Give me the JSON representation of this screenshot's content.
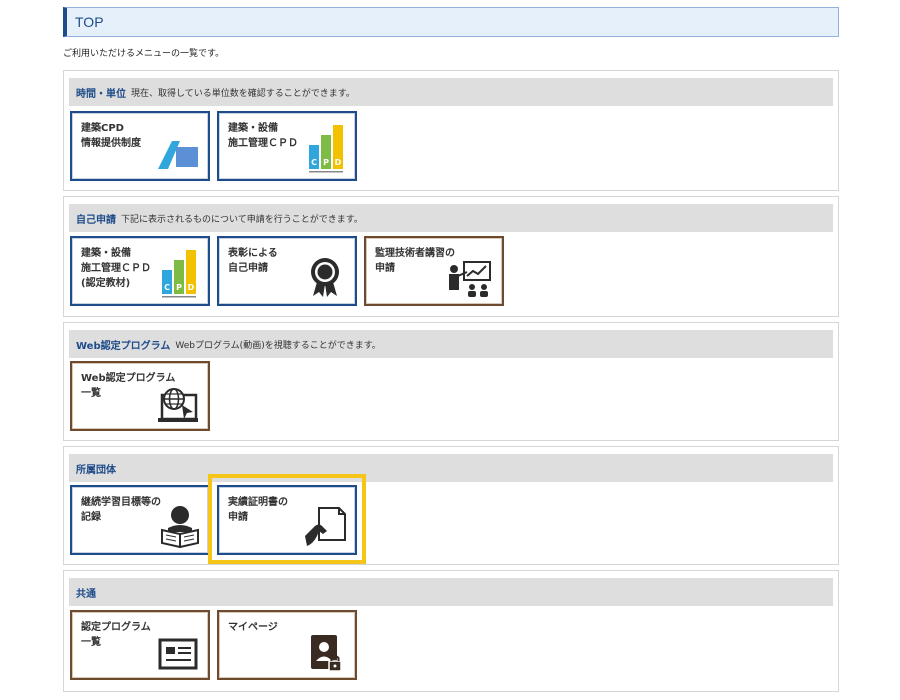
{
  "header": {
    "title": "TOP"
  },
  "intro": "ご利用いただけるメニューの一覧です。",
  "sections": [
    {
      "title": "時間・単位",
      "desc": "現在、取得している単位数を確認することができます。",
      "tiles": [
        {
          "label": "建築CPD\n情報提供制度",
          "icon": "kenchiku-cpd-logo-icon"
        },
        {
          "label": "建築・設備\n施工管理ＣＰＤ",
          "icon": "sekou-cpd-logo-icon"
        }
      ]
    },
    {
      "title": "自己申請",
      "desc": "下記に表示されるものについて申請を行うことができます。",
      "tiles": [
        {
          "label": "建築・設備\n施工管理ＣＰＤ\n(認定教材)",
          "icon": "sekou-cpd-logo-icon"
        },
        {
          "label": "表彰による\n自己申請",
          "icon": "award-medal-icon"
        },
        {
          "label": "監理技術者講習の\n申請",
          "icon": "lecture-presentation-icon"
        }
      ]
    },
    {
      "title": "Web認定プログラム",
      "desc": "Webプログラム(動画)を視聴することができます。",
      "tiles": [
        {
          "label": "Web認定プログラム\n一覧",
          "icon": "web-globe-monitor-icon"
        }
      ]
    },
    {
      "title": "所属団体",
      "desc": "",
      "tiles": [
        {
          "label": "継続学習目標等の\n記録",
          "icon": "reading-person-icon"
        },
        {
          "label": "実績証明書の\n申請",
          "icon": "hand-document-icon"
        }
      ]
    },
    {
      "title": "共通",
      "desc": "",
      "tiles": [
        {
          "label": "認定プログラム\n一覧",
          "icon": "id-card-list-icon"
        },
        {
          "label": "マイページ",
          "icon": "profile-lock-icon"
        }
      ]
    }
  ],
  "cpd_logo_letters": [
    "C",
    "P",
    "D"
  ],
  "colors": {
    "accent": "#1e4c8a",
    "tile_brown": "#6e4a2e",
    "highlight": "#f5c518",
    "cpd_blue": "#2fa6dc",
    "cpd_green": "#7dbb42",
    "cpd_yellow": "#f2c200"
  }
}
